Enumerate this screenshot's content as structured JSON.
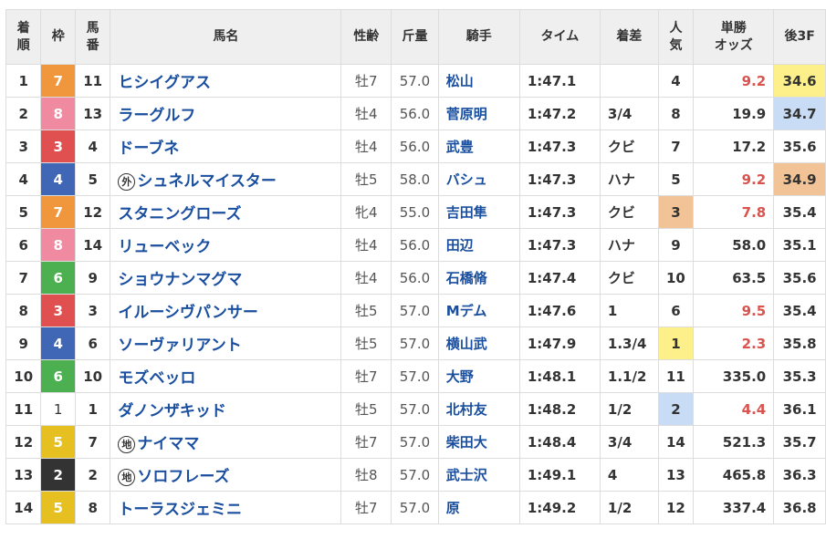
{
  "headers": {
    "rank": "着\n順",
    "waku": "枠",
    "umaban": "馬\n番",
    "name": "馬名",
    "sexage": "性齢",
    "weight": "斤量",
    "jockey": "騎手",
    "time": "タイム",
    "margin": "着差",
    "popularity": "人\n気",
    "odds": "単勝\nオッズ",
    "last3f": "後3F"
  },
  "colors": {
    "waku": {
      "1": "#ffffff",
      "2": "#333333",
      "3": "#e05050",
      "4": "#3f67b5",
      "5": "#e6c020",
      "6": "#4caf50",
      "7": "#f0963c",
      "8": "#ef8aa0"
    },
    "highlight_yellow": "#fdf08a",
    "highlight_blue": "#c9dcf6",
    "highlight_orange": "#f1c396",
    "horse_link": "#1a4fa0",
    "odds_popular": "#d9534f"
  },
  "rows": [
    {
      "rank": "1",
      "waku": "7",
      "umaban": "11",
      "mark": "",
      "name": "ヒシイグアス",
      "sexage": "牡7",
      "weight": "57.0",
      "jockey": "松山",
      "time": "1:47.1",
      "margin": "",
      "popularity": "4",
      "odds": "9.2",
      "last3f": "34.6",
      "pop_hl": "",
      "f3_hl": "yellow",
      "odds_red": true
    },
    {
      "rank": "2",
      "waku": "8",
      "umaban": "13",
      "mark": "",
      "name": "ラーグルフ",
      "sexage": "牡4",
      "weight": "56.0",
      "jockey": "菅原明",
      "time": "1:47.2",
      "margin": "3/4",
      "popularity": "8",
      "odds": "19.9",
      "last3f": "34.7",
      "pop_hl": "",
      "f3_hl": "blue",
      "odds_red": false
    },
    {
      "rank": "3",
      "waku": "3",
      "umaban": "4",
      "mark": "",
      "name": "ドーブネ",
      "sexage": "牡4",
      "weight": "56.0",
      "jockey": "武豊",
      "time": "1:47.3",
      "margin": "クビ",
      "popularity": "7",
      "odds": "17.2",
      "last3f": "35.6",
      "pop_hl": "",
      "f3_hl": "",
      "odds_red": false
    },
    {
      "rank": "4",
      "waku": "4",
      "umaban": "5",
      "mark": "外",
      "name": "シュネルマイスター",
      "sexage": "牡5",
      "weight": "58.0",
      "jockey": "バシュ",
      "time": "1:47.3",
      "margin": "ハナ",
      "popularity": "5",
      "odds": "9.2",
      "last3f": "34.9",
      "pop_hl": "",
      "f3_hl": "orange",
      "odds_red": true
    },
    {
      "rank": "5",
      "waku": "7",
      "umaban": "12",
      "mark": "",
      "name": "スタニングローズ",
      "sexage": "牝4",
      "weight": "55.0",
      "jockey": "吉田隼",
      "time": "1:47.3",
      "margin": "クビ",
      "popularity": "3",
      "odds": "7.8",
      "last3f": "35.4",
      "pop_hl": "orange",
      "f3_hl": "",
      "odds_red": true
    },
    {
      "rank": "6",
      "waku": "8",
      "umaban": "14",
      "mark": "",
      "name": "リューベック",
      "sexage": "牡4",
      "weight": "56.0",
      "jockey": "田辺",
      "time": "1:47.3",
      "margin": "ハナ",
      "popularity": "9",
      "odds": "58.0",
      "last3f": "35.1",
      "pop_hl": "",
      "f3_hl": "",
      "odds_red": false
    },
    {
      "rank": "7",
      "waku": "6",
      "umaban": "9",
      "mark": "",
      "name": "ショウナンマグマ",
      "sexage": "牡4",
      "weight": "56.0",
      "jockey": "石橋脩",
      "time": "1:47.4",
      "margin": "クビ",
      "popularity": "10",
      "odds": "63.5",
      "last3f": "35.6",
      "pop_hl": "",
      "f3_hl": "",
      "odds_red": false
    },
    {
      "rank": "8",
      "waku": "3",
      "umaban": "3",
      "mark": "",
      "name": "イルーシヴパンサー",
      "sexage": "牡5",
      "weight": "57.0",
      "jockey": "Mデム",
      "time": "1:47.6",
      "margin": "1",
      "popularity": "6",
      "odds": "9.5",
      "last3f": "35.4",
      "pop_hl": "",
      "f3_hl": "",
      "odds_red": true
    },
    {
      "rank": "9",
      "waku": "4",
      "umaban": "6",
      "mark": "",
      "name": "ソーヴァリアント",
      "sexage": "牡5",
      "weight": "57.0",
      "jockey": "横山武",
      "time": "1:47.9",
      "margin": "1.3/4",
      "popularity": "1",
      "odds": "2.3",
      "last3f": "35.8",
      "pop_hl": "yellow",
      "f3_hl": "",
      "odds_red": true
    },
    {
      "rank": "10",
      "waku": "6",
      "umaban": "10",
      "mark": "",
      "name": "モズベッロ",
      "sexage": "牡7",
      "weight": "57.0",
      "jockey": "大野",
      "time": "1:48.1",
      "margin": "1.1/2",
      "popularity": "11",
      "odds": "335.0",
      "last3f": "35.3",
      "pop_hl": "",
      "f3_hl": "",
      "odds_red": false
    },
    {
      "rank": "11",
      "waku": "1",
      "umaban": "1",
      "mark": "",
      "name": "ダノンザキッド",
      "sexage": "牡5",
      "weight": "57.0",
      "jockey": "北村友",
      "time": "1:48.2",
      "margin": "1/2",
      "popularity": "2",
      "odds": "4.4",
      "last3f": "36.1",
      "pop_hl": "blue",
      "f3_hl": "",
      "odds_red": true
    },
    {
      "rank": "12",
      "waku": "5",
      "umaban": "7",
      "mark": "地",
      "name": "ナイママ",
      "sexage": "牡7",
      "weight": "57.0",
      "jockey": "柴田大",
      "time": "1:48.4",
      "margin": "3/4",
      "popularity": "14",
      "odds": "521.3",
      "last3f": "35.7",
      "pop_hl": "",
      "f3_hl": "",
      "odds_red": false
    },
    {
      "rank": "13",
      "waku": "2",
      "umaban": "2",
      "mark": "地",
      "name": "ソロフレーズ",
      "sexage": "牡8",
      "weight": "57.0",
      "jockey": "武士沢",
      "time": "1:49.1",
      "margin": "4",
      "popularity": "13",
      "odds": "465.8",
      "last3f": "36.3",
      "pop_hl": "",
      "f3_hl": "",
      "odds_red": false
    },
    {
      "rank": "14",
      "waku": "5",
      "umaban": "8",
      "mark": "",
      "name": "トーラスジェミニ",
      "sexage": "牡7",
      "weight": "57.0",
      "jockey": "原",
      "time": "1:49.2",
      "margin": "1/2",
      "popularity": "12",
      "odds": "337.4",
      "last3f": "36.8",
      "pop_hl": "",
      "f3_hl": "",
      "odds_red": false
    }
  ]
}
